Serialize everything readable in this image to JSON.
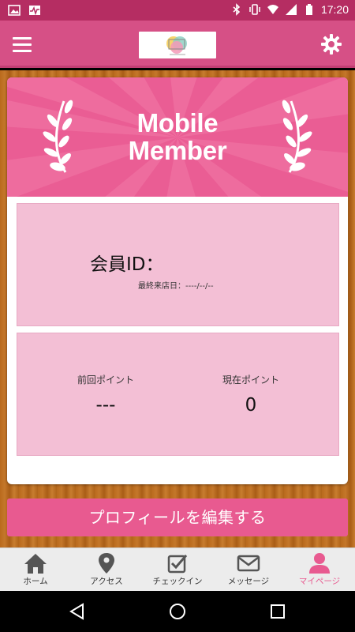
{
  "status_bar": {
    "time": "17:20",
    "left_icons": [
      "image-icon",
      "activity-icon"
    ],
    "right_icons": [
      "bluetooth-icon",
      "vibrate-icon",
      "wifi-icon",
      "signal-icon",
      "battery-icon"
    ]
  },
  "header": {
    "menu_icon": "hamburger-icon",
    "settings_icon": "gear-icon",
    "logo": "app-logo"
  },
  "banner": {
    "title_line1": "Mobile",
    "title_line2": "Member",
    "background": "#ea5d94"
  },
  "member": {
    "id_label": "会員ID：",
    "last_visit_label": "最終来店日：----/--/--"
  },
  "points": {
    "previous_label": "前回ポイント",
    "previous_value": "---",
    "current_label": "現在ポイント",
    "current_value": "0"
  },
  "actions": {
    "edit_profile_label": "プロフィールを編集する"
  },
  "tabs": [
    {
      "label": "ホーム",
      "icon": "home-icon"
    },
    {
      "label": "アクセス",
      "icon": "map-pin-icon"
    },
    {
      "label": "チェックイン",
      "icon": "checkbox-icon"
    },
    {
      "label": "メッセージ",
      "icon": "mail-icon"
    },
    {
      "label": "マイページ",
      "icon": "user-icon",
      "active": true
    }
  ],
  "colors": {
    "brand_pink": "#e85a90",
    "header_pink": "#d65086",
    "status_bar": "#b52d62",
    "panel_pink": "#f3bfd5"
  }
}
